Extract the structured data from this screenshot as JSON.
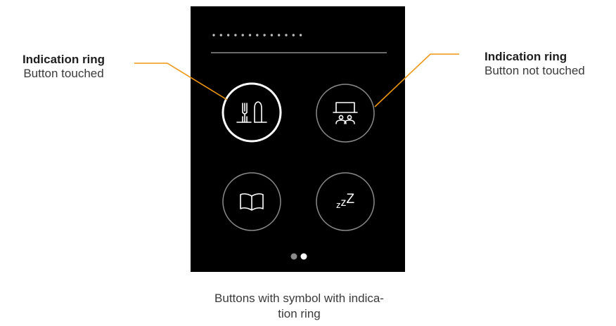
{
  "annotations": {
    "left": {
      "title": "Indication ring",
      "subtitle": "Button touched"
    },
    "right": {
      "title": "Indication ring",
      "subtitle": "Button not touched"
    }
  },
  "device": {
    "password_dots": 13,
    "buttons": [
      {
        "icon": "cutlery-icon",
        "state": "touched"
      },
      {
        "icon": "meeting-presentation-icon",
        "state": "not-touched"
      },
      {
        "icon": "open-book-icon",
        "state": "not-touched"
      },
      {
        "icon": "sleep-zzz-icon",
        "state": "not-touched",
        "label": "zzZ"
      }
    ],
    "page_indicator": {
      "pages": 2,
      "active": 2
    }
  },
  "caption": "Buttons with symbol with indica-\ntion ring",
  "colors": {
    "leader_line": "#f0960f",
    "device_bg": "#000000",
    "ring_touched": "#ffffff",
    "ring_idle": "#8a8a8a",
    "icon": "#ffffff"
  }
}
